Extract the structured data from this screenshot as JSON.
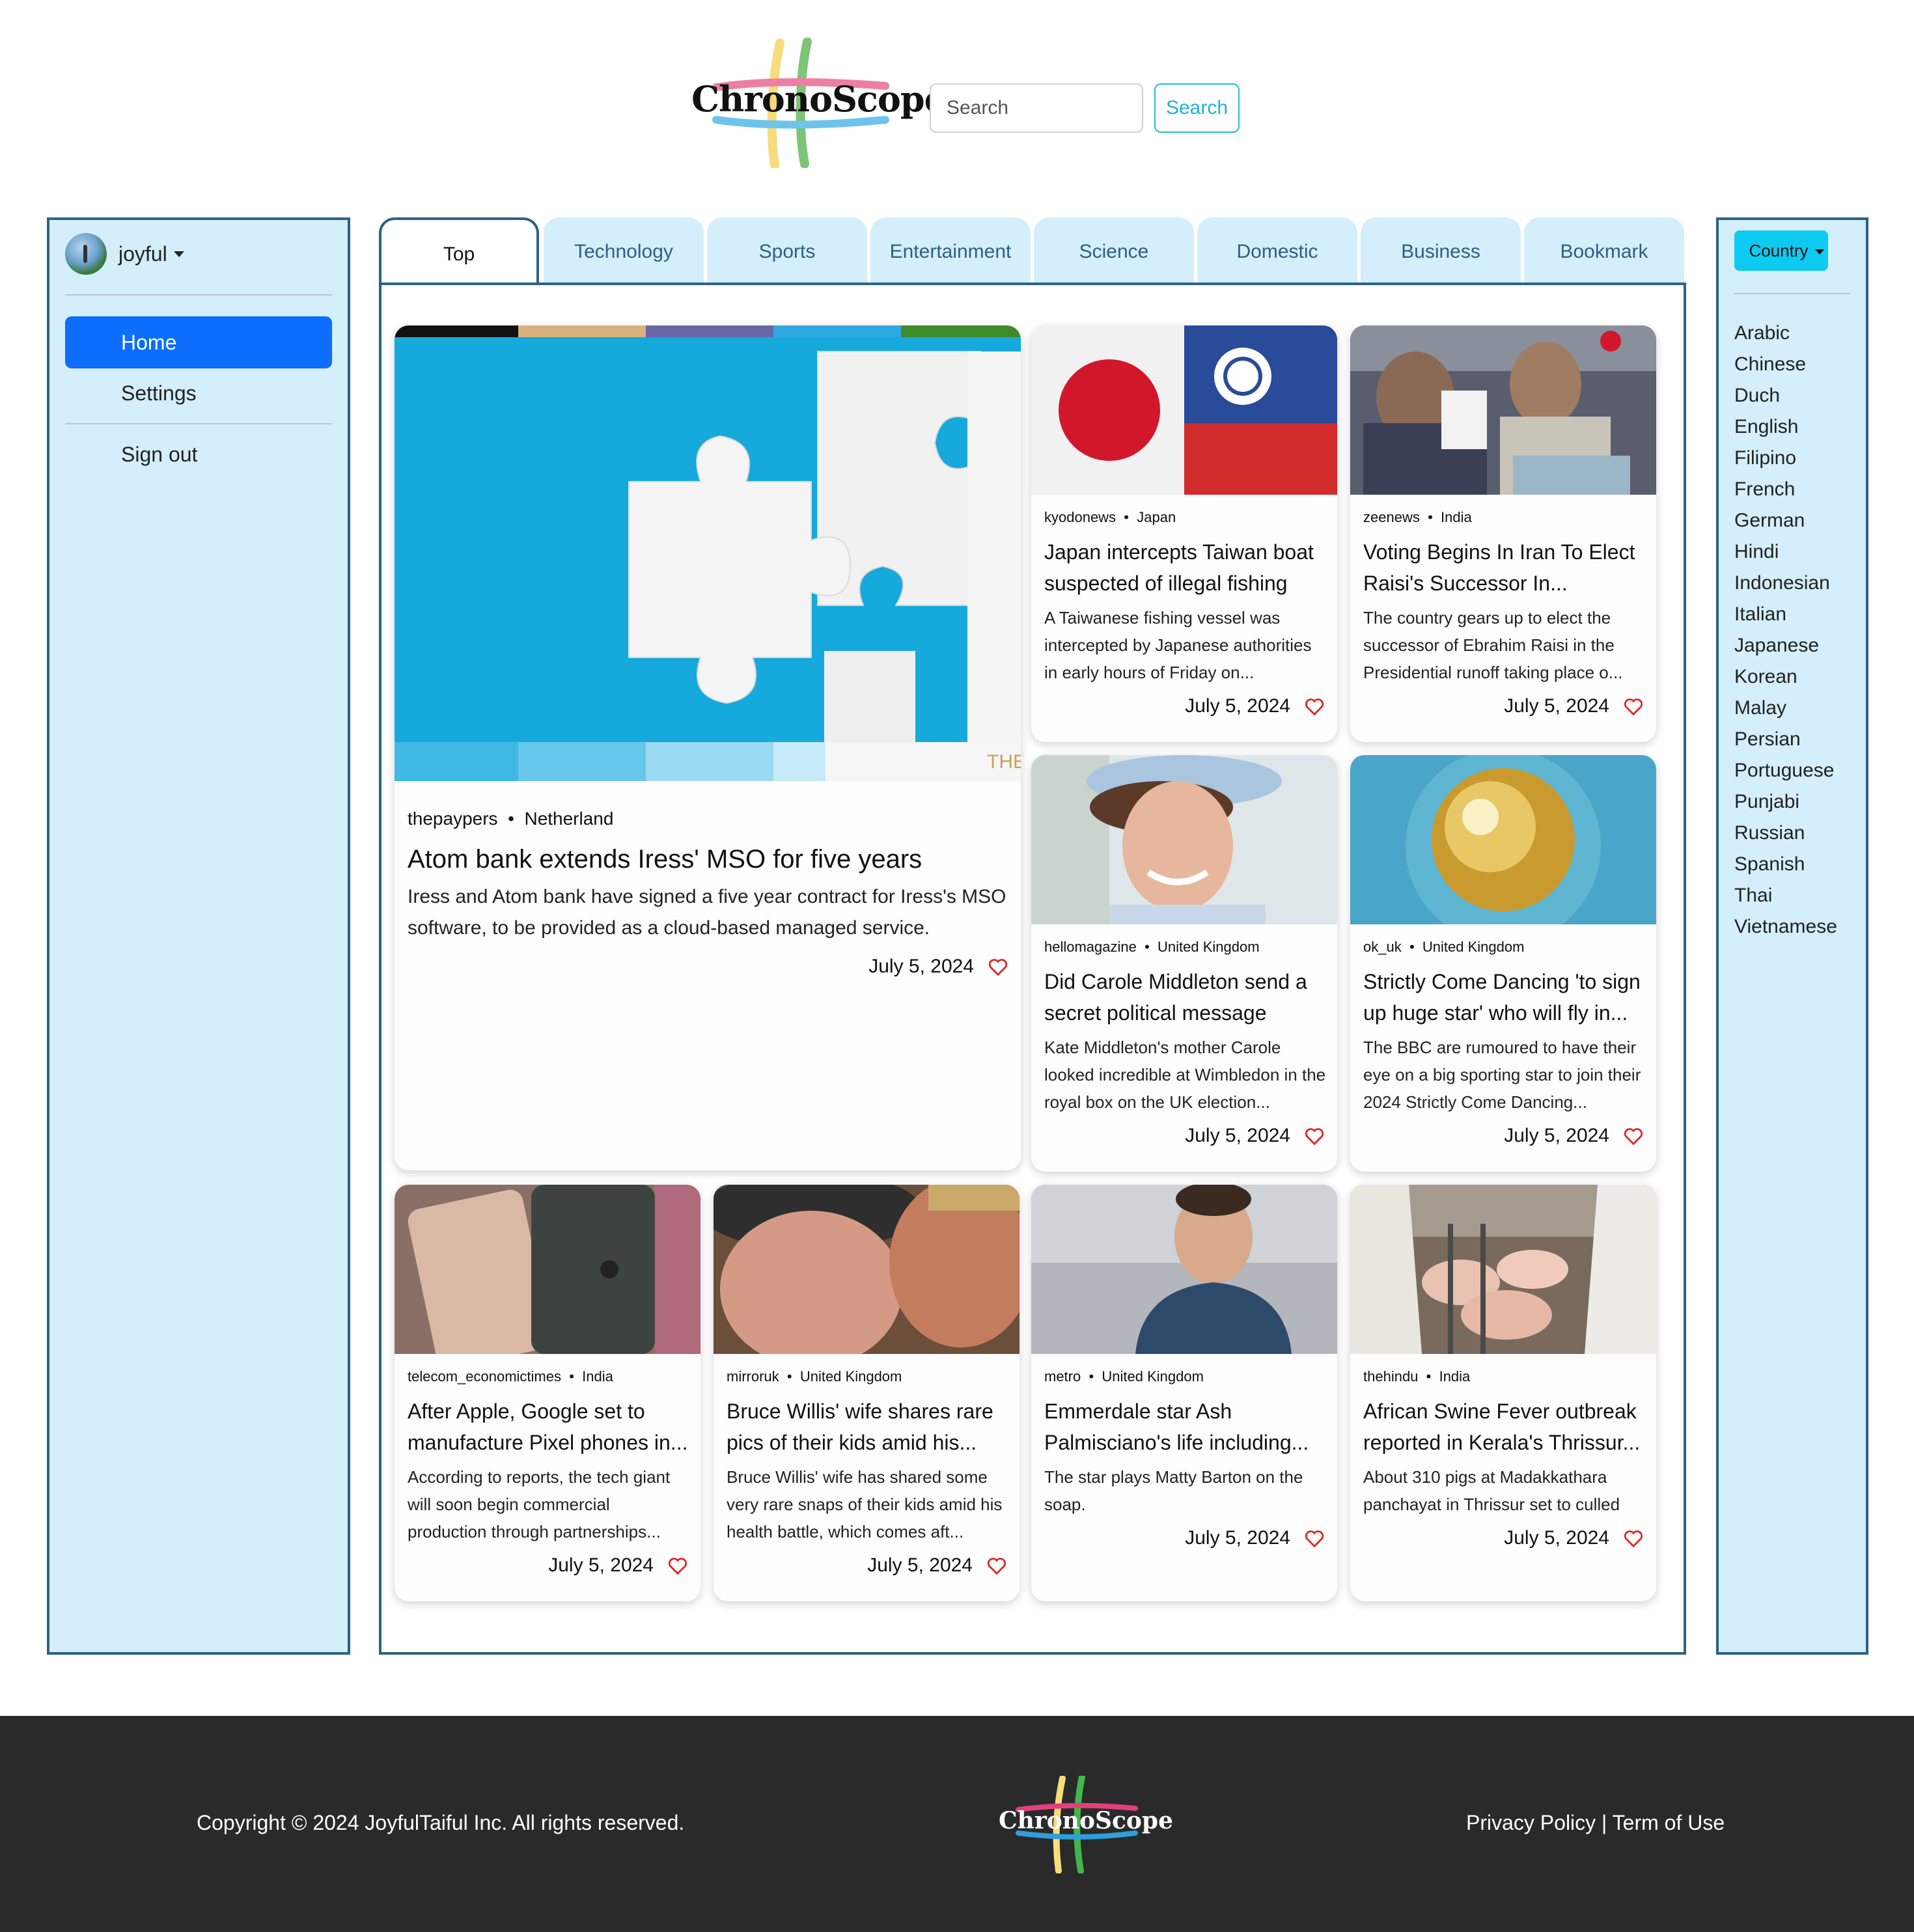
{
  "header": {
    "logo_text": "ChronoScope",
    "search_placeholder": "Search",
    "search_button": "Search"
  },
  "sidebar": {
    "user_name": "joyful",
    "nav": [
      {
        "label": "Home",
        "active": true
      },
      {
        "label": "Settings"
      },
      {
        "label": "Sign out"
      }
    ]
  },
  "tabs": [
    "Top",
    "Technology",
    "Sports",
    "Entertainment",
    "Science",
    "Domestic",
    "Business",
    "Bookmark"
  ],
  "country": {
    "button": "Country",
    "languages": [
      "Arabic",
      "Chinese",
      "Duch",
      "English",
      "Filipino",
      "French",
      "German",
      "Hindi",
      "Indonesian",
      "Italian",
      "Japanese",
      "Korean",
      "Malay",
      "Persian",
      "Portuguese",
      "Punjabi",
      "Russian",
      "Spanish",
      "Thai",
      "Vietnamese"
    ]
  },
  "articles": [
    {
      "source": "thepaypers",
      "country": "Netherland",
      "title": "Atom bank extends Iress' MSO for five years",
      "desc": "Iress and Atom bank have signed a five year contract for Iress's MSO software, to be provided as a cloud-based managed service.",
      "date": "July 5, 2024",
      "image": "puzzle-pieces"
    },
    {
      "source": "kyodonews",
      "country": "Japan",
      "title": "Japan intercepts Taiwan boat suspected of illegal fishing",
      "desc": "A Taiwanese fishing vessel was intercepted by Japanese authorities in early hours of Friday on...",
      "date": "July 5, 2024",
      "image": "japan-taiwan-flags"
    },
    {
      "source": "zeenews",
      "country": "India",
      "title": "Voting Begins In Iran To Elect Raisi's Successor In...",
      "desc": "The country gears up to elect the successor of Ebrahim Raisi in the Presidential runoff taking place o...",
      "date": "July 5, 2024",
      "image": "ballot-box"
    },
    {
      "source": "hellomagazine",
      "country": "United Kingdom",
      "title": "Did Carole Middleton send a secret political message with...",
      "desc": "Kate Middleton's mother Carole looked incredible at Wimbledon in the royal box on the UK election...",
      "date": "July 5, 2024",
      "image": "woman-hat"
    },
    {
      "source": "ok_uk",
      "country": "United Kingdom",
      "title": "Strictly Come Dancing 'to sign up huge star' who will fly in...",
      "desc": "The BBC are rumoured to have their eye on a big sporting star to join their 2024 Strictly Come Dancing...",
      "date": "July 5, 2024",
      "image": "glitter-ball"
    },
    {
      "source": "telecom_economictimes",
      "country": "India",
      "title": "After Apple, Google set to manufacture Pixel phones in...",
      "desc": "According to reports, the tech giant will soon begin commercial production through partnerships...",
      "date": "July 5, 2024",
      "image": "pixel-phones"
    },
    {
      "source": "mirroruk",
      "country": "United Kingdom",
      "title": "Bruce Willis' wife shares rare pics of their kids amid his...",
      "desc": "Bruce Willis' wife has shared some very rare snaps of their kids amid his health battle, which comes aft...",
      "date": "July 5, 2024",
      "image": "couple-kiss"
    },
    {
      "source": "metro",
      "country": "United Kingdom",
      "title": "Emmerdale star Ash Palmisciano's life including...",
      "desc": "The star plays Matty Barton on the soap.",
      "date": "July 5, 2024",
      "image": "man-smiling"
    },
    {
      "source": "thehindu",
      "country": "India",
      "title": "African Swine Fever outbreak reported in Kerala's Thrissur...",
      "desc": "About 310 pigs at Madakkathara panchayat in Thrissur set to culled",
      "date": "July 5, 2024",
      "image": "pig-farm"
    }
  ],
  "footer": {
    "copyright": "Copyright © 2024 JoyfulTaiful Inc. All rights reserved.",
    "logo_text": "ChronoScope",
    "privacy": "Privacy Policy",
    "separator": "|",
    "terms": "Term of Use"
  },
  "colors": {
    "panel_bg": "#d4eefb",
    "panel_border": "#2d6288",
    "primary": "#0d6efd",
    "country_btn": "#0dcaf0",
    "search_accent": "#1fb4cf",
    "heart": "#e02424",
    "footer_bg": "#2a2a2a"
  }
}
